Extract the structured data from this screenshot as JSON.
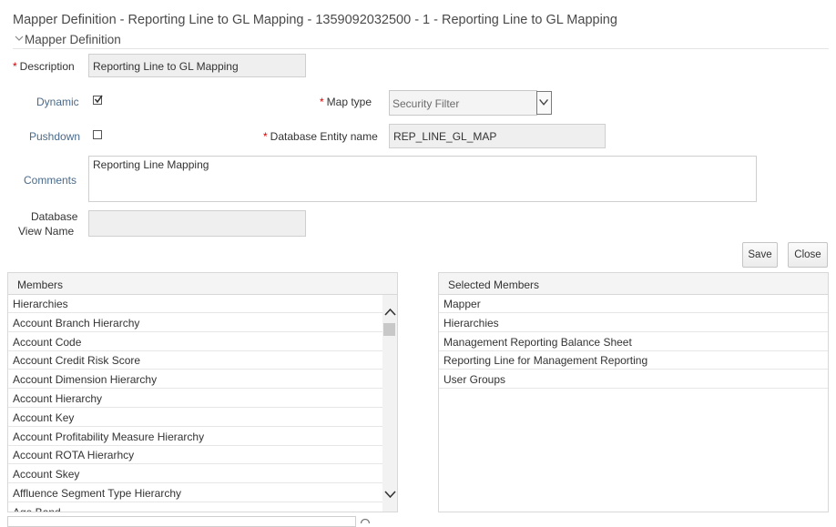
{
  "header": {
    "title": "Mapper Definition - Reporting Line to GL Mapping - 1359092032500 - 1 - Reporting Line to GL Mapping",
    "section_label": "Mapper Definition"
  },
  "form": {
    "description_label": "Description",
    "description_value": "Reporting Line to GL Mapping",
    "dynamic_label": "Dynamic",
    "dynamic_checked": true,
    "pushdown_label": "Pushdown",
    "pushdown_checked": false,
    "map_type_label": "Map type",
    "map_type_value": "Security Filter",
    "db_entity_label": "Database Entity name",
    "db_entity_value": "REP_LINE_GL_MAP",
    "comments_label": "Comments",
    "comments_value": "Reporting Line Mapping",
    "db_view_label_line1": "Database",
    "db_view_label_line2": "View Name",
    "db_view_value": "",
    "required_mark": "*"
  },
  "toolbar": {
    "save_label": "Save",
    "close_label": "Close"
  },
  "members": {
    "header": "Members",
    "items": [
      "Hierarchies",
      "Account Branch Hierarchy",
      "Account Code",
      "Account Credit Risk Score",
      "Account Dimension Hierarchy",
      "Account Hierarchy",
      "Account Key",
      "Account Profitability Measure Hierarchy",
      "Account ROTA Hierarhcy",
      "Account Skey",
      "Affluence Segment Type Hierarchy",
      "Age Band"
    ]
  },
  "selected_members": {
    "header": "Selected Members",
    "items": [
      "Mapper",
      "Hierarchies",
      "Management Reporting Balance Sheet",
      "Reporting Line for Management Reporting",
      "User Groups"
    ]
  },
  "icons": {
    "section_toggle": "chevron-down-icon",
    "map_type_dropdown": "chevron-down-icon",
    "dynamic_check": "checkmark-icon",
    "scroll_up": "chevron-up-icon",
    "scroll_down": "chevron-down-icon",
    "search": "search-icon"
  }
}
